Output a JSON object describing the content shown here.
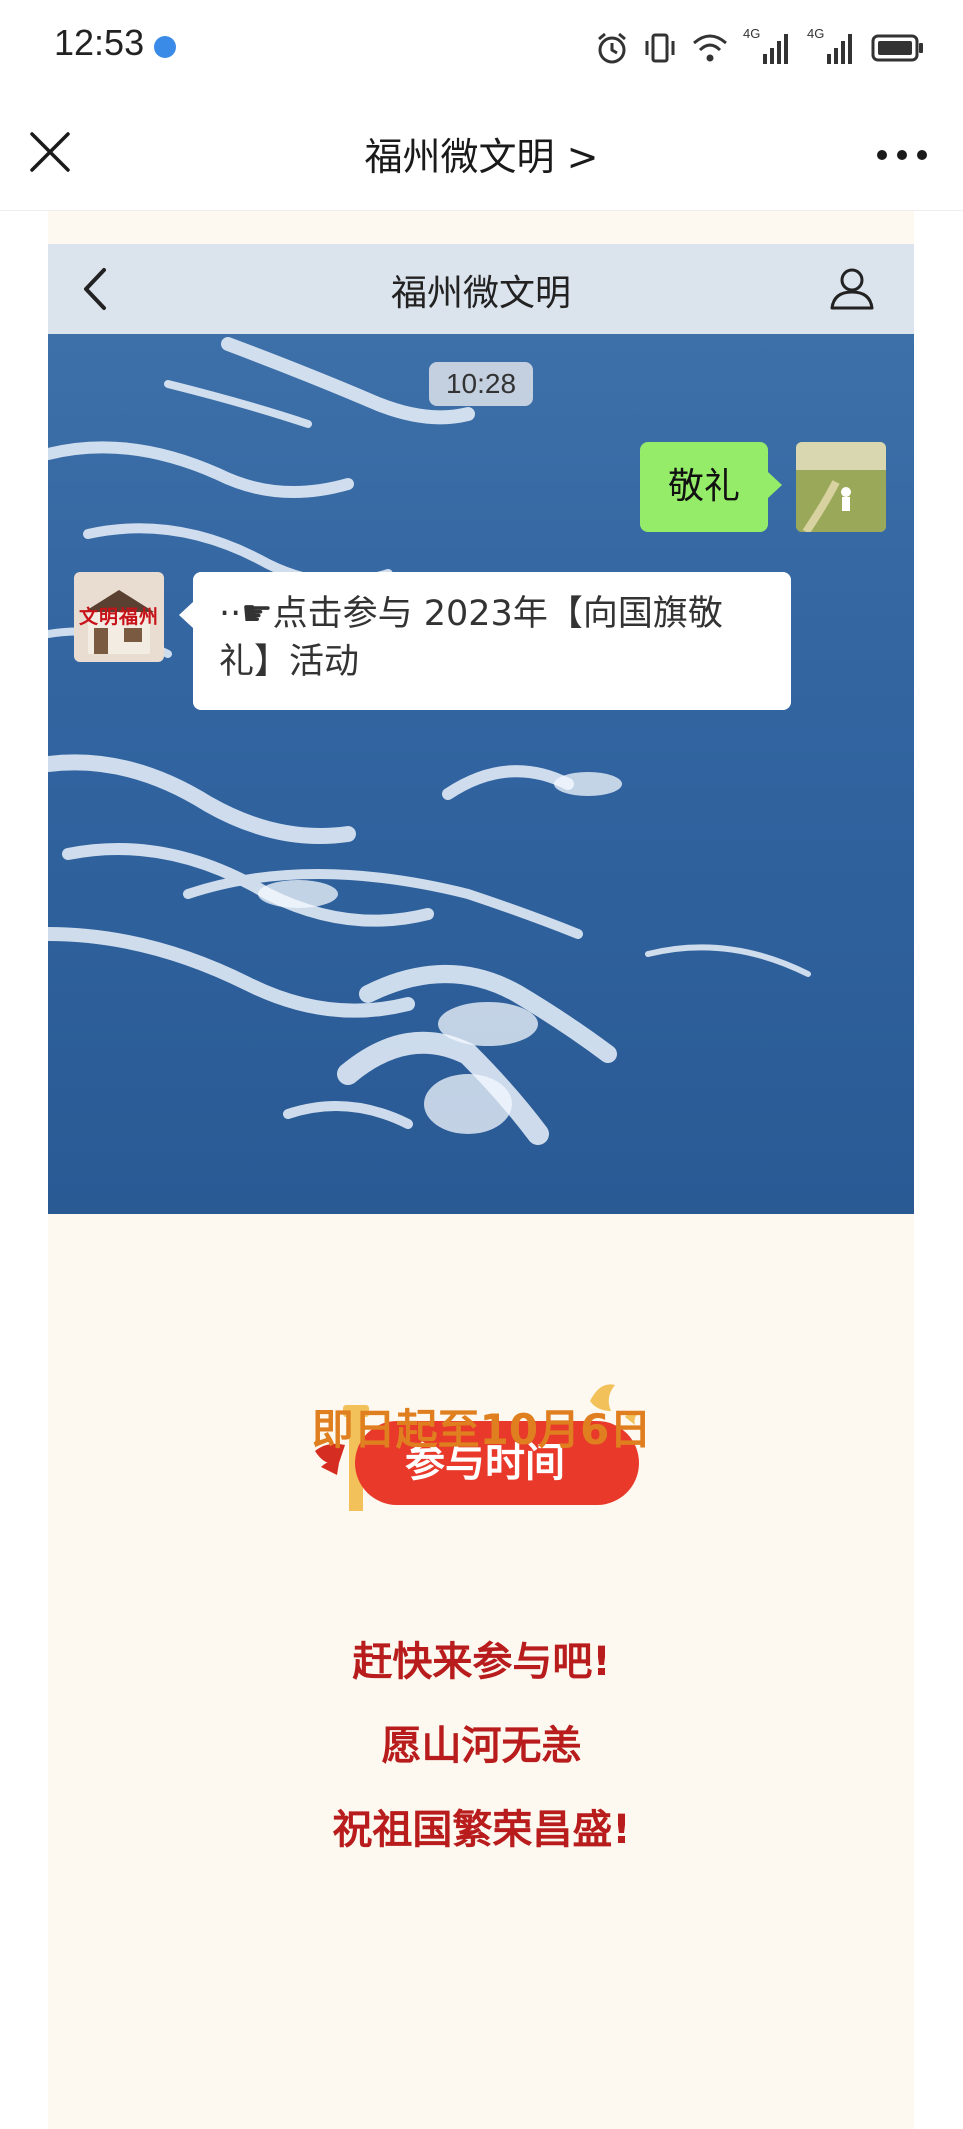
{
  "status_bar": {
    "time": "12:53",
    "net_label_1": "4G",
    "net_label_2": "4G"
  },
  "nav": {
    "title": "福州微文明 >"
  },
  "chat": {
    "title": "福州微文明",
    "timestamp": "10:28",
    "sent_message": "敬礼",
    "received_message": "··☛点击参与 2023年【向国旗敬礼】活动",
    "system_avatar_text": "文明福州"
  },
  "event": {
    "badge_label": "参与时间",
    "date": "即日起至10月6日",
    "lines": [
      "赶快来参与吧!",
      "愿山河无恙",
      "祝祖国繁荣昌盛!"
    ]
  },
  "colors": {
    "accent_red": "#e8392a",
    "date_orange": "#e07f1f",
    "slogan_red": "#b81c1c",
    "cream": "#fdf9f0",
    "wechat_green": "#95ec69"
  }
}
